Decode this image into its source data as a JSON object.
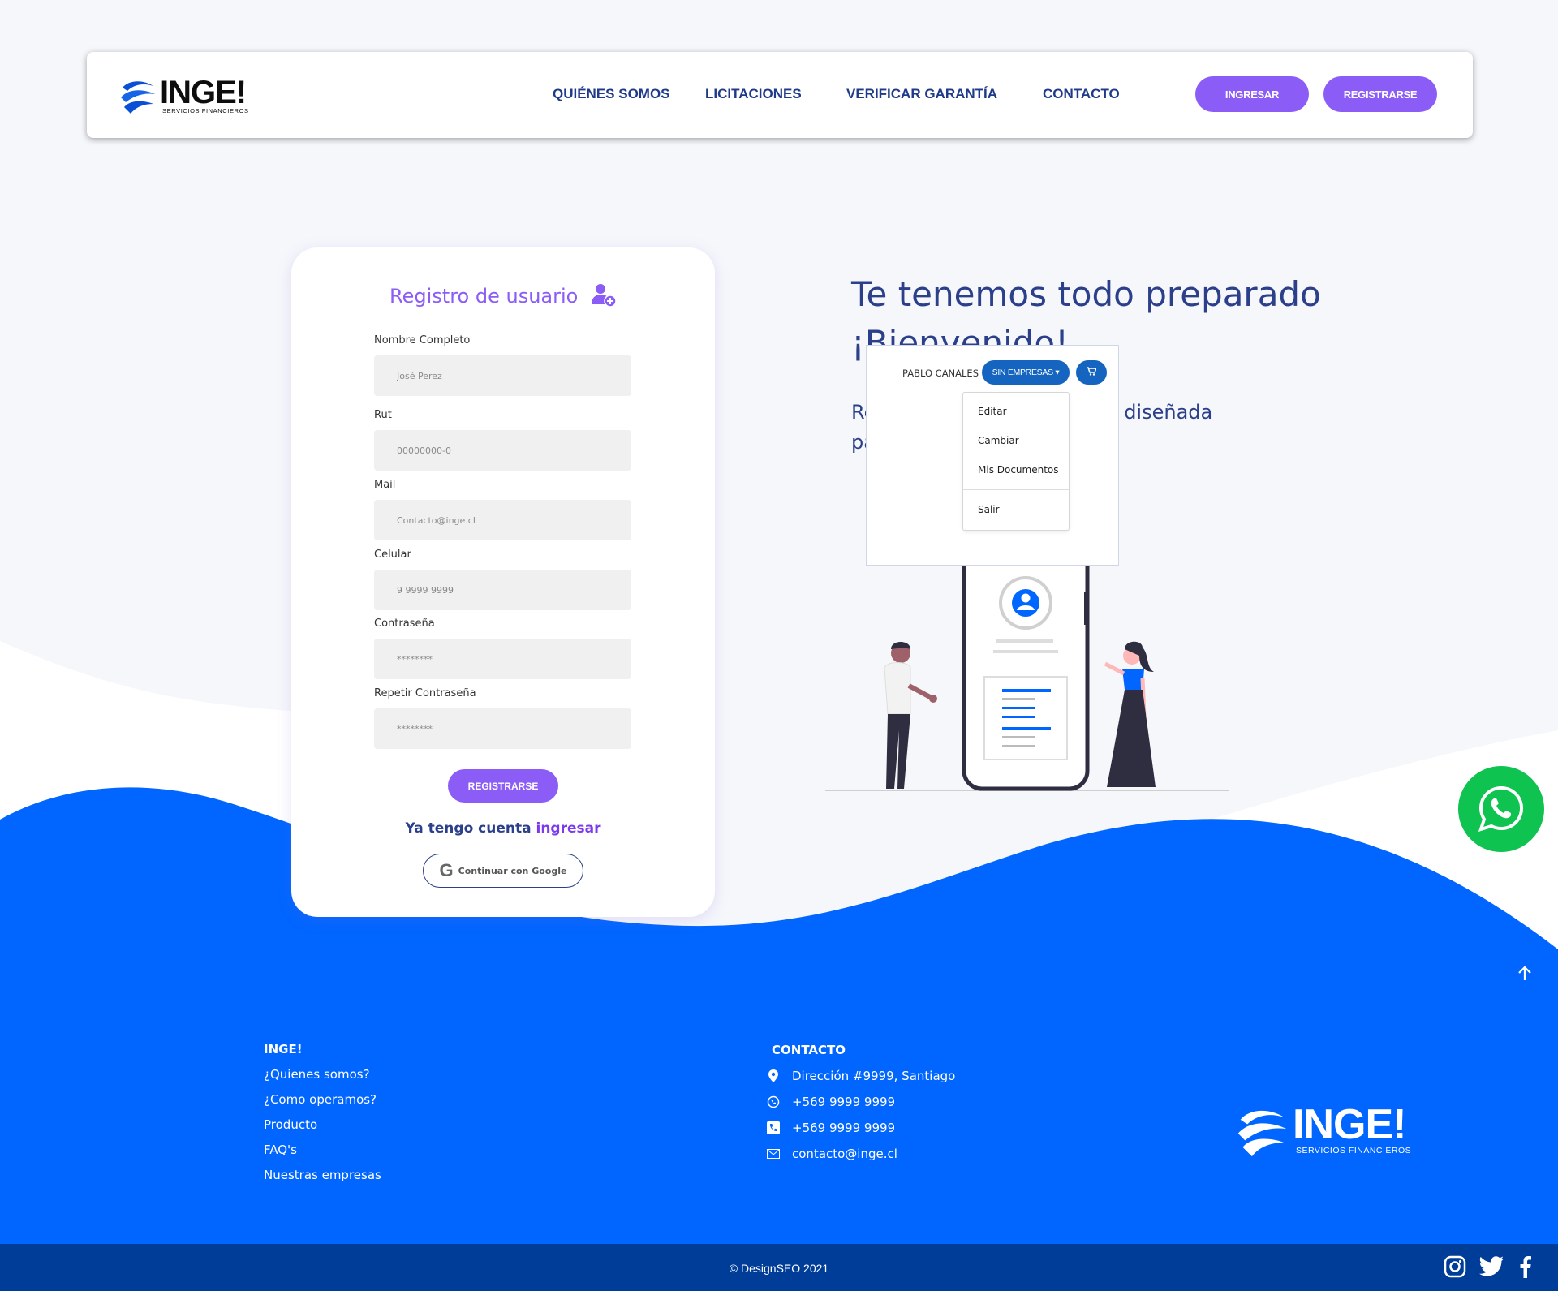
{
  "brand": {
    "name": "INGE!",
    "tagline": "SERVICIOS FINANCIEROS"
  },
  "nav": {
    "items": [
      {
        "label": "QUIÉNES SOMOS"
      },
      {
        "label": "LICITACIONES"
      },
      {
        "label": "VERIFICAR GARANTÍA"
      },
      {
        "label": "CONTACTO"
      }
    ],
    "login_label": "INGRESAR",
    "register_label": "REGISTRARSE"
  },
  "form": {
    "title": "Registro de usuario",
    "fields": [
      {
        "label": "Nombre Completo",
        "placeholder": "José Perez"
      },
      {
        "label": "Rut",
        "placeholder": "00000000-0"
      },
      {
        "label": "Mail",
        "placeholder": "Contacto@inge.cl"
      },
      {
        "label": "Celular",
        "placeholder": "9 9999 9999"
      },
      {
        "label": "Contraseña",
        "placeholder": "********"
      },
      {
        "label": "Repetir Contraseña",
        "placeholder": "********"
      }
    ],
    "submit_label": "REGISTRARSE",
    "have_account_text": "Ya tengo cuenta",
    "have_account_link": "ingresar",
    "google_label": "Continuar con Google"
  },
  "hero": {
    "title_line1": "Te tenemos todo preparado",
    "title_line2": "¡Bienvenido!",
    "sub_line1": "Registrate en la plataforma diseñada",
    "sub_line2": "para ti"
  },
  "user_menu": {
    "user_name": "PABLO CANALES",
    "company_label": "SIN EMPRESAS",
    "items": [
      "Editar",
      "Cambiar",
      "Mis Documentos"
    ],
    "logout_label": "Salir",
    "cart_icon": "cart-icon"
  },
  "footer": {
    "col1": {
      "title": "INGE!",
      "links": [
        "¿Quienes somos?",
        "¿Como operamos?",
        "Producto",
        "FAQ's",
        "Nuestras empresas"
      ]
    },
    "col2": {
      "title": "CONTACTO",
      "address": "Dirección #9999, Santiago",
      "whatsapp": "+569 9999 9999",
      "phone": "+569 9999 9999",
      "email": "contacto@inge.cl"
    },
    "copyright": "© DesignSEO 2021",
    "social": [
      "instagram-icon",
      "twitter-icon",
      "facebook-icon"
    ]
  },
  "colors": {
    "primary_blue": "#0066ff",
    "purple": "#8b5cf6",
    "navy_text": "#2b3f8a",
    "bottom_bar": "#003d99",
    "whatsapp_green": "#0ec34f"
  }
}
